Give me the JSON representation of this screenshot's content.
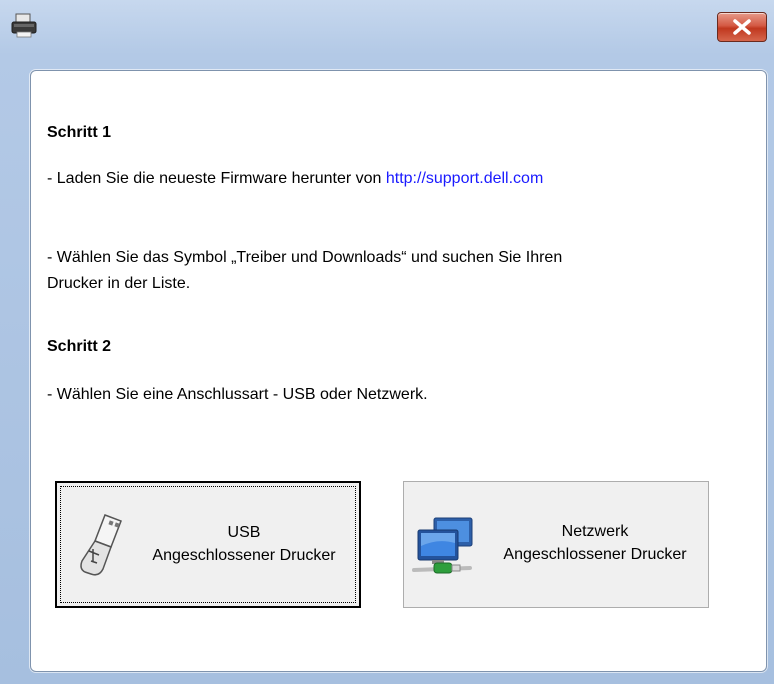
{
  "window": {
    "close_label": "x"
  },
  "step1": {
    "heading": "Schritt 1",
    "line1_text": "- Laden Sie die neueste Firmware herunter von ",
    "line1_link": "http://support.dell.com",
    "line2a": "- Wählen Sie das Symbol „Treiber und Downloads“ und suchen Sie Ihren",
    "line2b": "Drucker in der Liste."
  },
  "step2": {
    "heading": "Schritt 2",
    "line1": "- Wählen Sie eine Anschlussart - USB oder Netzwerk."
  },
  "buttons": {
    "usb": {
      "title": "USB",
      "subtitle": "Angeschlossener Drucker",
      "icon": "usb-stick-icon"
    },
    "network": {
      "title": "Netzwerk",
      "subtitle": "Angeschlossener Drucker",
      "icon": "network-computers-icon"
    }
  }
}
